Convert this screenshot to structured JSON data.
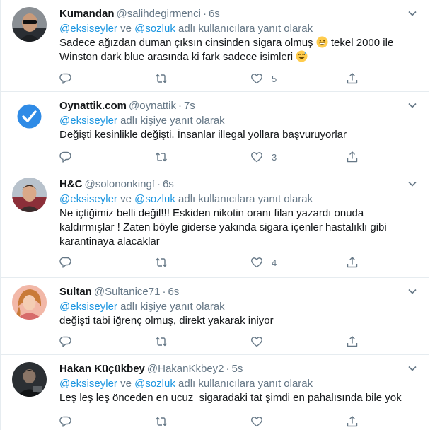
{
  "tweets": [
    {
      "name": "Kumandan",
      "handle": "@salihdegirmenci",
      "dot": "·",
      "time": "6s",
      "reply_prefix": "",
      "reply_mentions": [
        "@eksiseyler",
        "@sozluk"
      ],
      "reply_joiner": " ve ",
      "reply_suffix": " adlı kullanıcılara yanıt olarak",
      "text_lines": [
        "Sadece ağızdan duman çıksın cinsinden sigara olmuş",
        "tekel 2000 ile",
        "Winston dark blue arasında ki fark sadece isimleri"
      ],
      "reply_count": "",
      "retweet_count": "",
      "like_count": "5",
      "avatar": "man-with-sunglasses-avatar"
    },
    {
      "name": "Oynattik.com",
      "handle": "@oynattik",
      "dot": "·",
      "time": "7s",
      "reply_mentions": [
        "@eksiseyler"
      ],
      "reply_suffix": " adlı kişiye yanıt olarak",
      "text_lines": [
        "Değişti kesinlikle değişti. İnsanlar illegal yollara başvuruyorlar"
      ],
      "like_count": "3",
      "avatar": "blue-checkmark-avatar"
    },
    {
      "name": "H&C",
      "handle": "@solononkingf",
      "dot": "·",
      "time": "6s",
      "reply_mentions": [
        "@eksiseyler",
        "@sozluk"
      ],
      "reply_joiner": " ve ",
      "reply_suffix": " adlı kullanıcılara yanıt olarak",
      "text_lines": [
        "Ne içtiğimiz belli değil!!! Eskiden nikotin oranı filan yazardı onuda",
        "kaldırmışlar ! Zaten böyle giderse yakında sigara içenler hastalıklı gibi",
        "karantinaya alacaklar"
      ],
      "like_count": "4",
      "avatar": "man-portrait-avatar"
    },
    {
      "name": "Sultan",
      "handle": "@Sultanice71",
      "dot": "·",
      "time": "6s",
      "reply_mentions": [
        "@eksiseyler"
      ],
      "reply_suffix": " adlı kişiye yanıt olarak",
      "text_lines": [
        "değişti tabi iğrenç olmuş, direkt yakarak iniyor"
      ],
      "like_count": "",
      "avatar": "woman-portrait-avatar"
    },
    {
      "name": "Hakan Küçükbey",
      "handle": "@HakanKkbey2",
      "dot": "·",
      "time": "5s",
      "reply_mentions": [
        "@eksiseyler",
        "@sozluk"
      ],
      "reply_joiner": " ve ",
      "reply_suffix": " adlı kullanıcılara yanıt olarak",
      "text_lines": [
        "Leş leş leş önceden en ucuz  sigaradaki tat şimdi en pahalısında bile yok"
      ],
      "like_count": "",
      "avatar": "man-dark-avatar"
    }
  ],
  "colors": {
    "accent": "#1b95e0",
    "muted": "#657786",
    "text": "#14171a",
    "border": "#e6ecf0",
    "icon": "#657786"
  }
}
